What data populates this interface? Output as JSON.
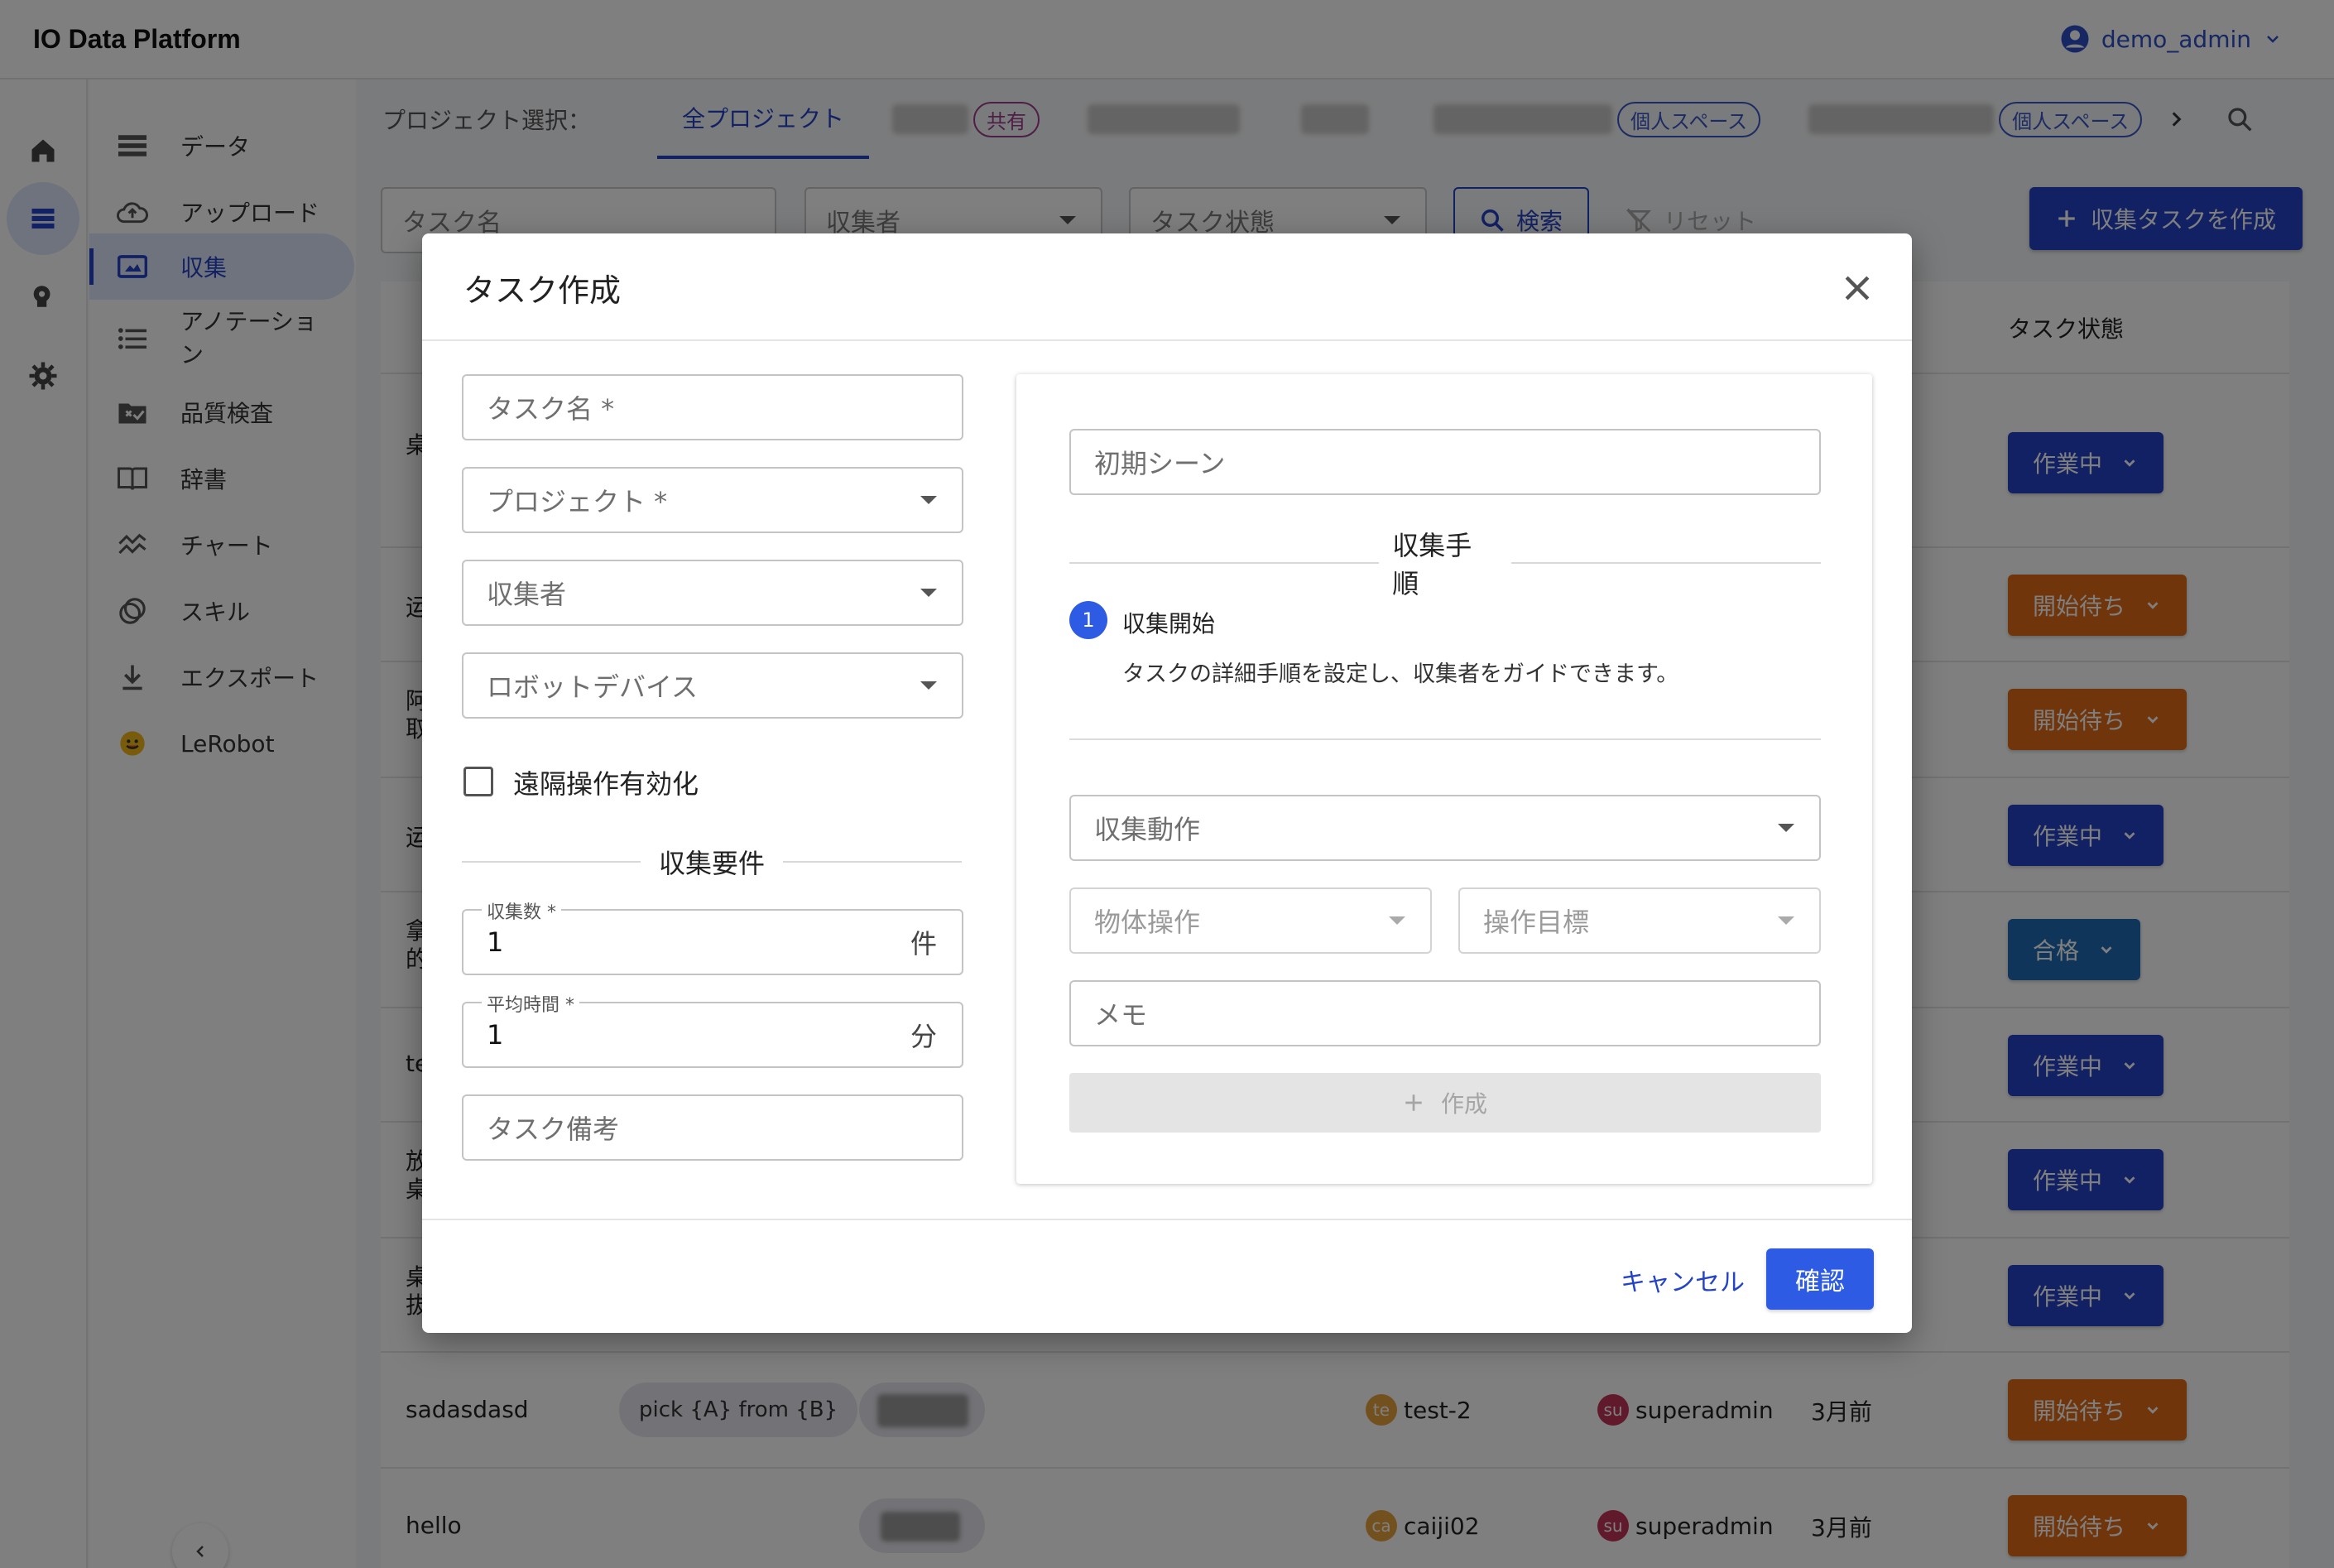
{
  "app": {
    "title": "IO Data Platform",
    "user": "demo_admin"
  },
  "sidebar": {
    "items": [
      {
        "label": "データ"
      },
      {
        "label": "アップロード"
      },
      {
        "label": "収集"
      },
      {
        "label": "アノテーション"
      },
      {
        "label": "品質検査"
      },
      {
        "label": "辞書"
      },
      {
        "label": "チャート"
      },
      {
        "label": "スキル"
      },
      {
        "label": "エクスポート"
      },
      {
        "label": "LeRobot"
      }
    ],
    "active_index": 2
  },
  "projects": {
    "label": "プロジェクト選択：",
    "active_tab": "全プロジェクト",
    "tags": {
      "shared": "共有",
      "personal": "個人スペース"
    }
  },
  "filters": {
    "task_name_placeholder": "タスク名",
    "collector_placeholder": "収集者",
    "status_placeholder": "タスク状態",
    "search_label": "検索",
    "reset_label": "リセット",
    "create_label": "収集タスクを作成"
  },
  "table": {
    "status_header": "タスク状態",
    "rows": [
      {
        "name": "桌",
        "status": "作業中",
        "status_color": "#2443c6"
      },
      {
        "name": "运",
        "status": "開始待ち",
        "status_color": "#e06a15"
      },
      {
        "name": "阿\n取",
        "status": "開始待ち",
        "status_color": "#e06a15"
      },
      {
        "name": "运",
        "status": "作業中",
        "status_color": "#2443c6"
      },
      {
        "name": "拿\n的",
        "status": "合格",
        "status_color": "#1e6db4"
      },
      {
        "name": "te",
        "status": "作業中",
        "status_color": "#2443c6"
      },
      {
        "name": "放\n桌",
        "status": "作業中",
        "status_color": "#2443c6"
      },
      {
        "name": "桌\n拔",
        "status": "作業中",
        "status_color": "#2443c6"
      },
      {
        "name": "sadasdasd",
        "skill": "pick {A} from {B}",
        "collector": "test-2",
        "collector_avatar": "te",
        "creator": "superadmin",
        "creator_avatar": "su",
        "time": "3月前",
        "status": "開始待ち",
        "status_color": "#e06a15"
      },
      {
        "name": "hello",
        "collector": "caiji02",
        "collector_avatar": "ca",
        "creator": "superadmin",
        "creator_avatar": "su",
        "time": "3月前",
        "status": "開始待ち",
        "status_color": "#e06a15"
      }
    ]
  },
  "modal": {
    "title": "タスク作成",
    "task_name_placeholder": "タスク名 *",
    "project_placeholder": "プロジェクト *",
    "collector_placeholder": "収集者",
    "robot_placeholder": "ロボットデバイス",
    "remote_label": "遠隔操作有効化",
    "requirements_title": "収集要件",
    "count_label": "収集数 *",
    "count_value": "1",
    "count_unit": "件",
    "avg_time_label": "平均時間 *",
    "avg_time_value": "1",
    "avg_time_unit": "分",
    "note_placeholder": "タスク備考",
    "initial_scene_placeholder": "初期シーン",
    "steps_title": "収集手順",
    "step_number": "1",
    "step_title": "収集開始",
    "step_desc": "タスクの詳細手順を設定し、収集者をガイドできます。",
    "action_placeholder": "収集動作",
    "object_placeholder": "物体操作",
    "target_placeholder": "操作目標",
    "memo_placeholder": "メモ",
    "add_label": "作成",
    "cancel_label": "キャンセル",
    "confirm_label": "確認"
  }
}
